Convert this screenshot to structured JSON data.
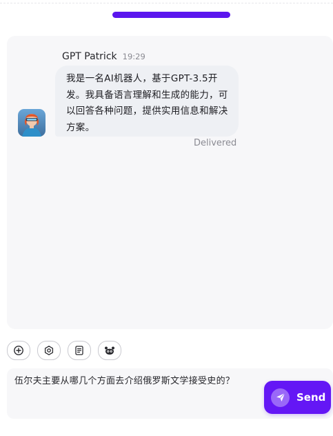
{
  "header": {
    "progress_color": "#5b16ee"
  },
  "message": {
    "sender": "GPT Patrick",
    "time": "19:29",
    "text": "我是一名AI机器人，基于GPT-3.5开发。我具备语言理解和生成的能力，可以回答各种问题，提供实用信息和解决方案。",
    "status": "Delivered",
    "avatar_icon": "robot-avatar-icon"
  },
  "toolbar": {
    "items": [
      {
        "icon": "add-circle-icon"
      },
      {
        "icon": "settings-gear-icon"
      },
      {
        "icon": "document-icon"
      },
      {
        "icon": "bot-face-icon"
      }
    ]
  },
  "composer": {
    "value": "伍尔夫主要从哪几个方面去介绍俄罗斯文学接受史的？",
    "send_label": "Send",
    "send_icon": "paper-plane-icon",
    "accent": "#6417f5"
  }
}
